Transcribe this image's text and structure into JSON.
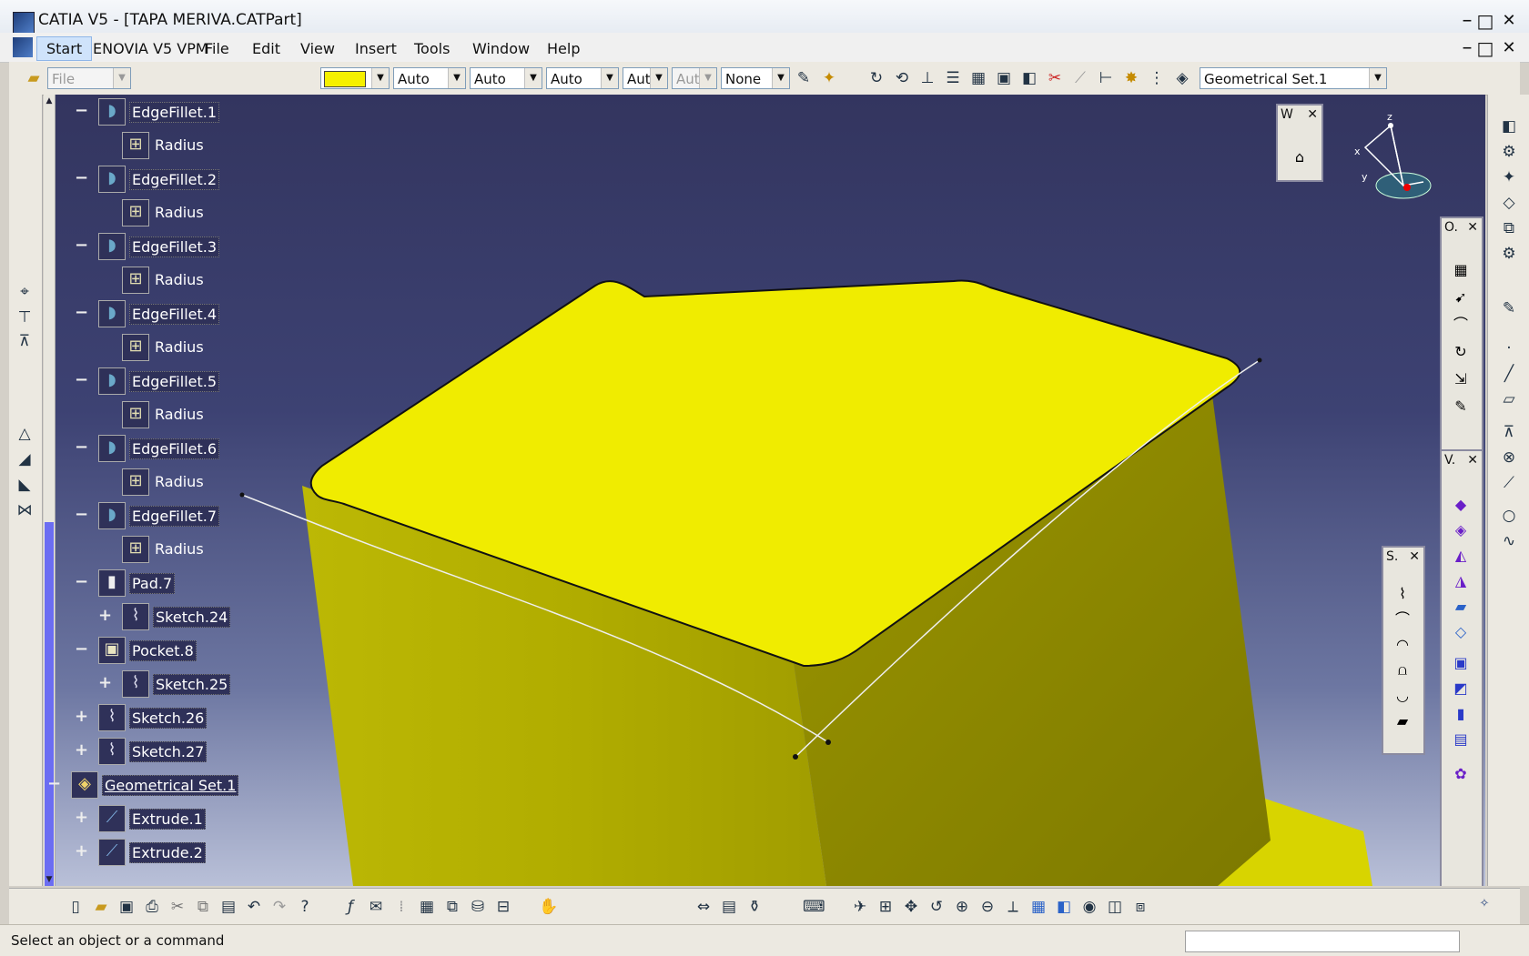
{
  "window": {
    "title": "CATIA V5 - [TAPA MERIVA.CATPart]",
    "minimize_glyph": "–",
    "restore_glyph": "□",
    "close_glyph": "✕"
  },
  "menubar": {
    "items": [
      "Start",
      "ENOVIA V5 VPM",
      "File",
      "Edit",
      "View",
      "Insert",
      "Tools",
      "Window",
      "Help"
    ]
  },
  "toolbar_top": {
    "file_combo": "File",
    "color_value": "#f5f000",
    "line_type": "Auto",
    "line_weight": "Auto",
    "point_style": "Auto",
    "layer_aut_1": "Aut",
    "layer_aut_2": "Aut",
    "render_style": "None",
    "current_set": "Geometrical Set.1"
  },
  "tree": {
    "nodes": [
      {
        "label": "EdgeFillet.1",
        "level": 1,
        "icon": "edge-fillet-icon"
      },
      {
        "label": "Radius",
        "level": 2,
        "icon": "parameter-icon"
      },
      {
        "label": "EdgeFillet.2",
        "level": 1,
        "icon": "edge-fillet-icon"
      },
      {
        "label": "Radius",
        "level": 2,
        "icon": "parameter-icon"
      },
      {
        "label": "EdgeFillet.3",
        "level": 1,
        "icon": "edge-fillet-icon"
      },
      {
        "label": "Radius",
        "level": 2,
        "icon": "parameter-icon"
      },
      {
        "label": "EdgeFillet.4",
        "level": 1,
        "icon": "edge-fillet-icon"
      },
      {
        "label": "Radius",
        "level": 2,
        "icon": "parameter-icon"
      },
      {
        "label": "EdgeFillet.5",
        "level": 1,
        "icon": "edge-fillet-icon"
      },
      {
        "label": "Radius",
        "level": 2,
        "icon": "parameter-icon"
      },
      {
        "label": "EdgeFillet.6",
        "level": 1,
        "icon": "edge-fillet-icon"
      },
      {
        "label": "Radius",
        "level": 2,
        "icon": "parameter-icon"
      },
      {
        "label": "EdgeFillet.7",
        "level": 1,
        "icon": "edge-fillet-icon"
      },
      {
        "label": "Radius",
        "level": 2,
        "icon": "parameter-icon"
      },
      {
        "label": "Pad.7",
        "level": 1,
        "icon": "pad-icon"
      },
      {
        "label": "Sketch.24",
        "level": 2,
        "icon": "sketch-icon"
      },
      {
        "label": "Pocket.8",
        "level": 1,
        "icon": "pocket-icon"
      },
      {
        "label": "Sketch.25",
        "level": 2,
        "icon": "sketch-icon"
      },
      {
        "label": "Sketch.26",
        "level": 1,
        "icon": "sketch-icon"
      },
      {
        "label": "Sketch.27",
        "level": 1,
        "icon": "sketch-icon"
      },
      {
        "label": "Geometrical Set.1",
        "level": 0,
        "icon": "geometrical-set-icon"
      },
      {
        "label": "Extrude.1",
        "level": 1,
        "icon": "extrude-icon"
      },
      {
        "label": "Extrude.2",
        "level": 1,
        "icon": "extrude-icon"
      }
    ]
  },
  "floating_toolbars": {
    "w": {
      "title": "W",
      "close": "✕"
    },
    "o": {
      "title": "O.",
      "close": "✕"
    },
    "v": {
      "title": "V.",
      "close": "✕"
    },
    "s": {
      "title": "S.",
      "close": "✕"
    }
  },
  "compass": {
    "x": "x",
    "y": "y",
    "z": "z"
  },
  "statusbar": {
    "message": "Select an object or a command"
  },
  "colors": {
    "part_yellow": "#f0ec00",
    "viewport_top": "#33355f",
    "viewport_bottom": "#b9c0d8"
  }
}
